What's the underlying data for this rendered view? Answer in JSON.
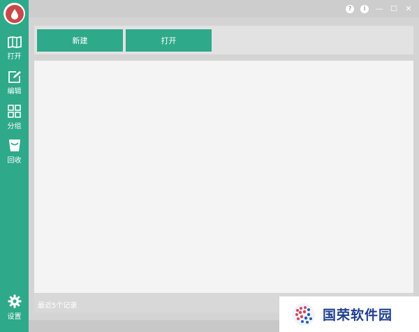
{
  "sidebar": {
    "items": [
      {
        "label": "打开",
        "icon": "book-icon"
      },
      {
        "label": "编辑",
        "icon": "edit-icon"
      },
      {
        "label": "分组",
        "icon": "grid-icon"
      },
      {
        "label": "回收",
        "icon": "recycle-bag-icon"
      }
    ],
    "settings_label": "设置"
  },
  "titlebar": {
    "help_glyph": "?",
    "info_glyph": "i",
    "minimize_glyph": "—",
    "maximize_glyph": "☐",
    "close_glyph": "✕"
  },
  "toolbar": {
    "new_label": "新建",
    "open_label": "打开"
  },
  "status": {
    "text": "最近5个记录"
  },
  "watermark": {
    "text": "国荣软件园"
  },
  "colors": {
    "accent": "#2ea98a",
    "logo_red": "#c94a4a"
  }
}
